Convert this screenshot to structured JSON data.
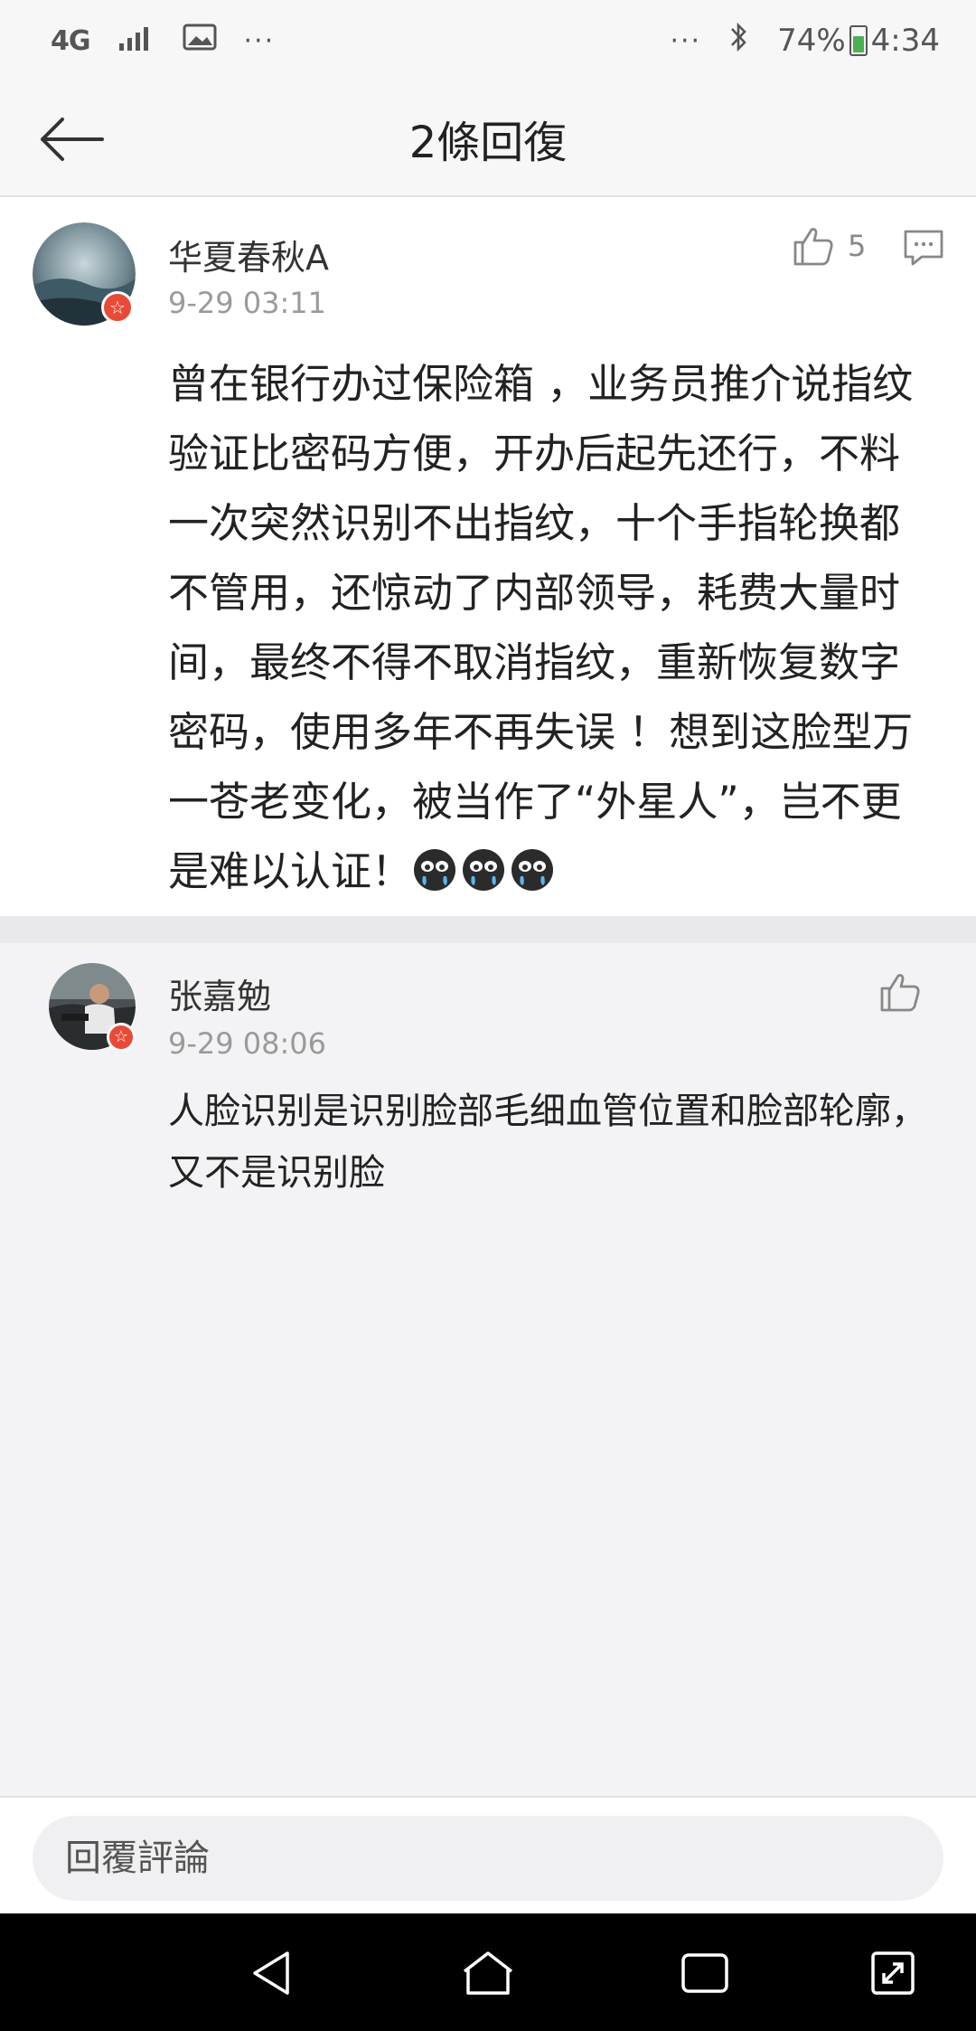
{
  "status_bar": {
    "network": "4G",
    "dots_left": "···",
    "dots_right": "···",
    "battery": "74%",
    "time": "4:34",
    "battery_level": 0.74,
    "battery_color": "#4caf50"
  },
  "header": {
    "title": "2條回復"
  },
  "main_comment": {
    "username": "华夏春秋A",
    "timestamp": "9-29 03:11",
    "likes": "5",
    "text": "曾在银行办过保险箱 ，业务员推介说指纹验证比密码方便，开办后起先还行，不料一次突然识别不出指纹，十个手指轮换都不管用，还惊动了内部领导，耗费大量时间，最终不得不取消指纹，重新恢复数字密码，使用多年不再失误 ！想到这脸型万一苍老变化，被当作了“外星人”，岂不更是难以认证！",
    "emoji_count": 3,
    "badge_color": "#e94a38"
  },
  "reply_comment": {
    "username": "张嘉勉",
    "timestamp": "9-29 08:06",
    "text": "人脸识别是识别脸部毛细血管位置和脸部轮廓，又不是识别脸"
  },
  "reply_bar": {
    "placeholder": "回覆評論"
  },
  "icons": {
    "back": "arrow-left-icon",
    "like": "thumbs-up-icon",
    "reply": "comment-icon",
    "verified": "star-badge-icon",
    "nav_back": "triangle-back-icon",
    "nav_home": "home-icon",
    "nav_recents": "square-icon",
    "nav_expand": "expand-icon"
  }
}
